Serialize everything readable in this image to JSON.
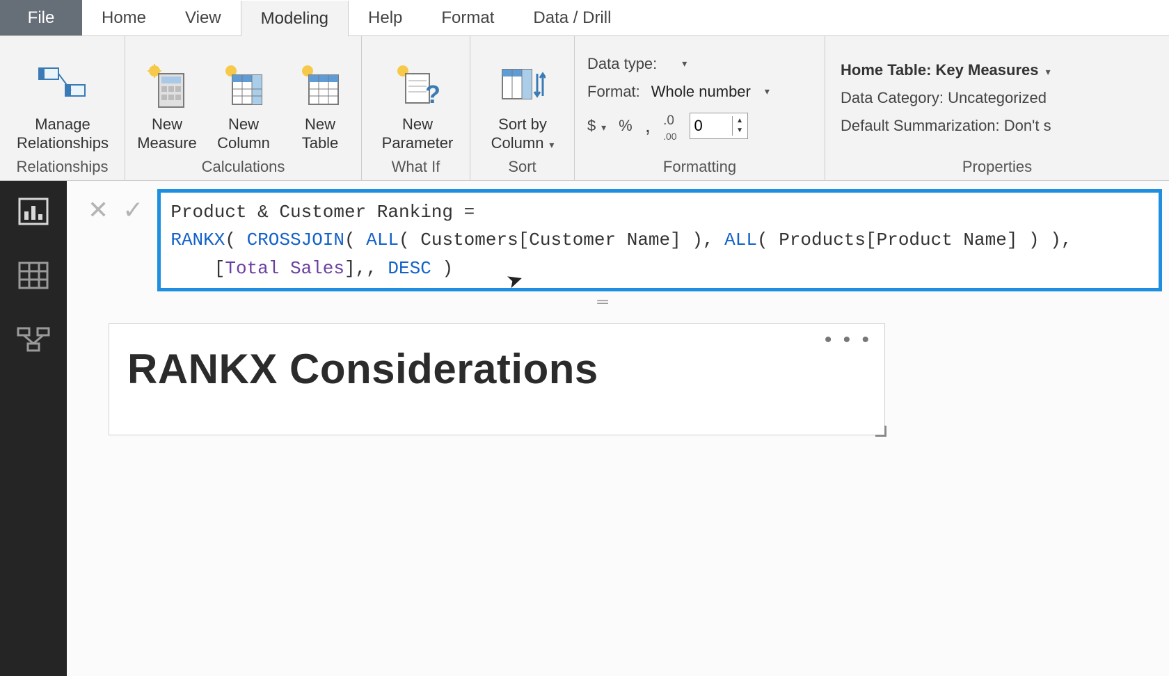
{
  "menubar": {
    "file": "File",
    "tabs": [
      "Home",
      "View",
      "Modeling",
      "Help",
      "Format",
      "Data / Drill"
    ],
    "active_index": 2
  },
  "ribbon": {
    "groups": {
      "relationships": {
        "label": "Relationships",
        "manage": "Manage\nRelationships"
      },
      "calculations": {
        "label": "Calculations",
        "new_measure": "New\nMeasure",
        "new_column": "New\nColumn",
        "new_table": "New\nTable"
      },
      "whatif": {
        "label": "What If",
        "new_parameter": "New\nParameter"
      },
      "sort": {
        "label": "Sort",
        "sort_by": "Sort by\nColumn"
      },
      "formatting": {
        "label": "Formatting",
        "data_type_label": "Data type:",
        "data_type_value": "",
        "format_label": "Format:",
        "format_value": "Whole number",
        "currency": "$",
        "percent": "%",
        "thousands": ",",
        "decimal_icon": ".00",
        "decimal_places": "0"
      },
      "properties": {
        "label": "Properties",
        "home_table_label": "Home Table:",
        "home_table_value": "Key Measures",
        "data_category_label": "Data Category:",
        "data_category_value": "Uncategorized",
        "default_summ_label": "Default Summarization:",
        "default_summ_value": "Don't s"
      }
    }
  },
  "formula": {
    "line1_plain": "Product & Customer Ranking = ",
    "rankx": "RANKX",
    "open1": "( ",
    "crossjoin": "CROSSJOIN",
    "open2": "( ",
    "all1": "ALL",
    "open3": "( ",
    "col1": "Customers[Customer Name]",
    "close3": " ), ",
    "all2": "ALL",
    "open4": "( ",
    "col2": "Products[Product Name]",
    "close4": " ) ),",
    "indent": "    [",
    "measure": "Total Sales",
    "mid": "],, ",
    "desc": "DESC",
    "close_final": " )"
  },
  "visual": {
    "title": "RANKX Considerations",
    "more": "• • •"
  },
  "sidebar": {
    "items": [
      "report-view",
      "data-view",
      "model-view"
    ]
  }
}
